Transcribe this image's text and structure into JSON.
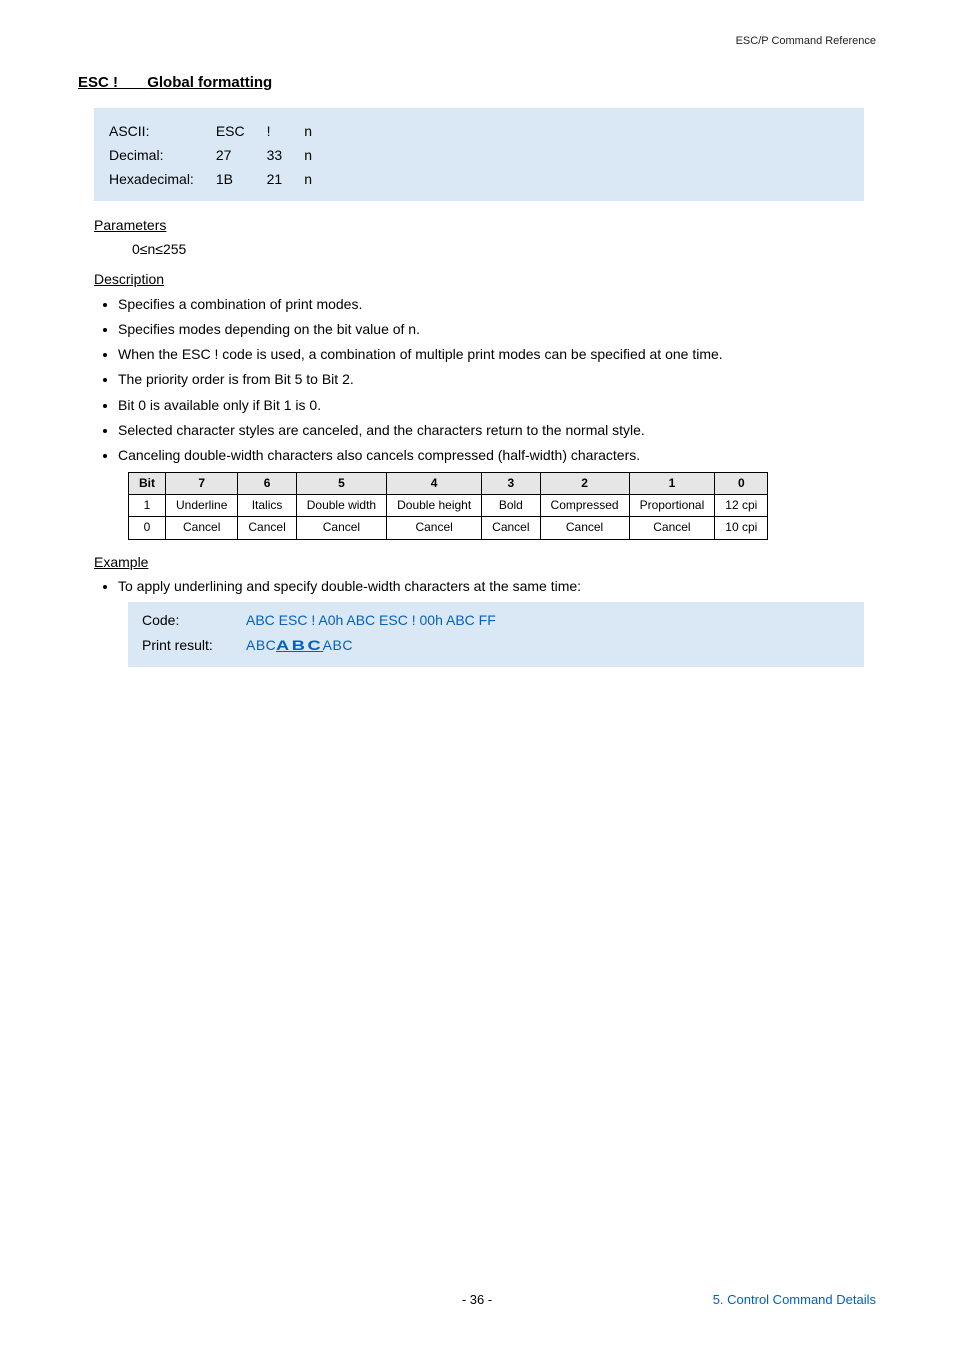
{
  "header": {
    "topRight": "ESC/P Command Reference"
  },
  "titleRow": {
    "left": "ESC !",
    "right": "Global formatting"
  },
  "codeTable": {
    "rows": [
      {
        "label": "ASCII:",
        "c1": "ESC",
        "c2": "!",
        "c3": "n"
      },
      {
        "label": "Decimal:",
        "c1": "27",
        "c2": "33",
        "c3": "n"
      },
      {
        "label": "Hexadecimal:",
        "c1": "1B",
        "c2": "21",
        "c3": "n"
      }
    ]
  },
  "headings": {
    "parameters": "Parameters",
    "description": "Description",
    "example": "Example"
  },
  "parametersText": "0≤n≤255",
  "descBullets": [
    "Specifies a combination of print modes.",
    "Specifies modes depending on the bit value of n.",
    "When the ESC ! code is used, a combination of multiple print modes can be specified at one time.",
    "The priority order is from Bit 5 to Bit 2.",
    "Bit 0 is available only if Bit 1 is 0.",
    "Selected character styles are canceled, and the characters return to the normal style.",
    "Canceling double-width characters also cancels compressed (half-width) characters."
  ],
  "bitTable": {
    "headers": [
      "Bit",
      "7",
      "6",
      "5",
      "4",
      "3",
      "2",
      "1",
      "0"
    ],
    "rows": [
      [
        "1",
        "Underline",
        "Italics",
        "Double width",
        "Double height",
        "Bold",
        "Compressed",
        "Proportional",
        "12 cpi"
      ],
      [
        "0",
        "Cancel",
        "Cancel",
        "Cancel",
        "Cancel",
        "Cancel",
        "Cancel",
        "Cancel",
        "10 cpi"
      ]
    ]
  },
  "exampleBullet": "To apply underlining and specify double-width characters at the same time:",
  "exampleBox": {
    "codeLabel": "Code:",
    "codeValue": "ABC ESC !   A0h ABC ESC !   00h ABC FF",
    "printLabel": "Print result:",
    "print1": "ABC",
    "print2": "ABC",
    "print3": "ABC"
  },
  "footer": {
    "pageNum": "- 36 -",
    "bottomRight": "5. Control Command Details"
  }
}
